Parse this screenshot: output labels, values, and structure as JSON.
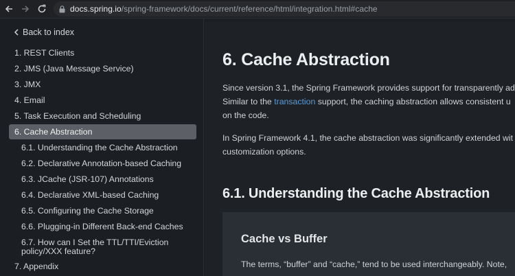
{
  "browser": {
    "url_host": "docs.spring.io",
    "url_path": "/spring-framework/docs/current/reference/html/integration.html#cache"
  },
  "sidebar": {
    "back_label": "Back to index",
    "items": [
      {
        "label": "1. REST Clients"
      },
      {
        "label": "2. JMS (Java Message Service)"
      },
      {
        "label": "3. JMX"
      },
      {
        "label": "4. Email"
      },
      {
        "label": "5. Task Execution and Scheduling"
      },
      {
        "label": "6. Cache Abstraction"
      },
      {
        "label": "6.1. Understanding the Cache Abstraction"
      },
      {
        "label": "6.2. Declarative Annotation-based Caching"
      },
      {
        "label": "6.3. JCache (JSR-107) Annotations"
      },
      {
        "label": "6.4. Declarative XML-based Caching"
      },
      {
        "label": "6.5. Configuring the Cache Storage"
      },
      {
        "label": "6.6. Plugging-in Different Back-end Caches"
      },
      {
        "label": "6.7. How can I Set the TTL/TTI/Eviction policy/XXX feature?"
      },
      {
        "label": "7. Appendix"
      }
    ]
  },
  "main": {
    "title": "6. Cache Abstraction",
    "para1_line1": "Since version 3.1, the Spring Framework provides support for transparently ad",
    "para1_line2_before": "Similar to the ",
    "para1_link": "transaction",
    "para1_line2_after": " support, the caching abstraction allows consistent u",
    "para1_line3": "on the code.",
    "para2_line1": "In Spring Framework 4.1, the cache abstraction was significantly extended wit",
    "para2_line2": "customization options.",
    "section_title": "6.1. Understanding the Cache Abstraction",
    "block_title": "Cache vs Buffer",
    "block_line1": "The terms, “buffer” and “cache,” tend to be used interchangeably. Note,"
  },
  "colors": {
    "accent_link": "#5b9bd5",
    "active_item_bg": "#5c6066"
  }
}
